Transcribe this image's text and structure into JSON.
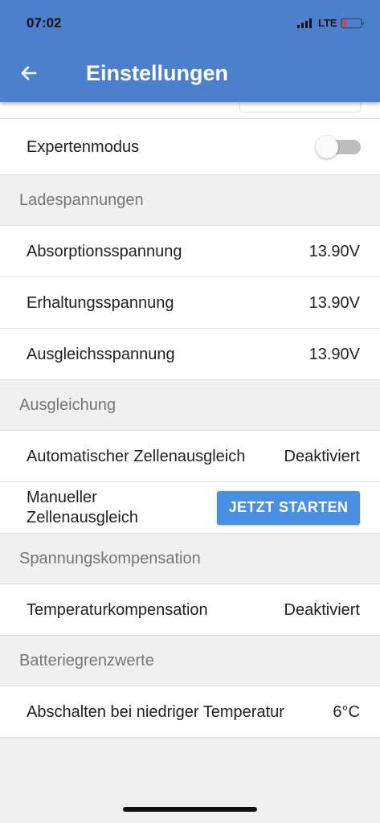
{
  "status_bar": {
    "time": "07:02",
    "network": "LTE",
    "signal_icon": "signal-bars-icon",
    "battery_icon": "battery-low-icon"
  },
  "header": {
    "title": "Einstellungen",
    "back_icon": "arrow-left-icon"
  },
  "expert_mode": {
    "label": "Expertenmodus",
    "enabled": false
  },
  "sections": [
    {
      "title": "Ladespannungen",
      "items": [
        {
          "label": "Absorptionsspannung",
          "value": "13.90V"
        },
        {
          "label": "Erhaltungsspannung",
          "value": "13.90V"
        },
        {
          "label": "Ausgleichsspannung",
          "value": "13.90V"
        }
      ]
    },
    {
      "title": "Ausgleichung",
      "items": [
        {
          "label": "Automatischer Zellenausgleich",
          "value": "Deaktiviert"
        },
        {
          "label": "Manueller Zellenausgleich",
          "button_label": "JETZT STARTEN"
        }
      ]
    },
    {
      "title": "Spannungskompensation",
      "items": [
        {
          "label": "Temperaturkompensation",
          "value": "Deaktiviert"
        }
      ]
    },
    {
      "title": "Batteriegrenzwerte",
      "items": [
        {
          "label": "Abschalten bei niedriger Temperatur",
          "value": "6°C"
        }
      ]
    }
  ],
  "colors": {
    "header": "#4c80cc",
    "accent": "#4a90e2",
    "section_background": "#f0f0f0",
    "section_text": "#757575",
    "divider": "#dddddd",
    "toggle_track_off": "#bdbdbd",
    "battery_level": "#e5423b"
  }
}
